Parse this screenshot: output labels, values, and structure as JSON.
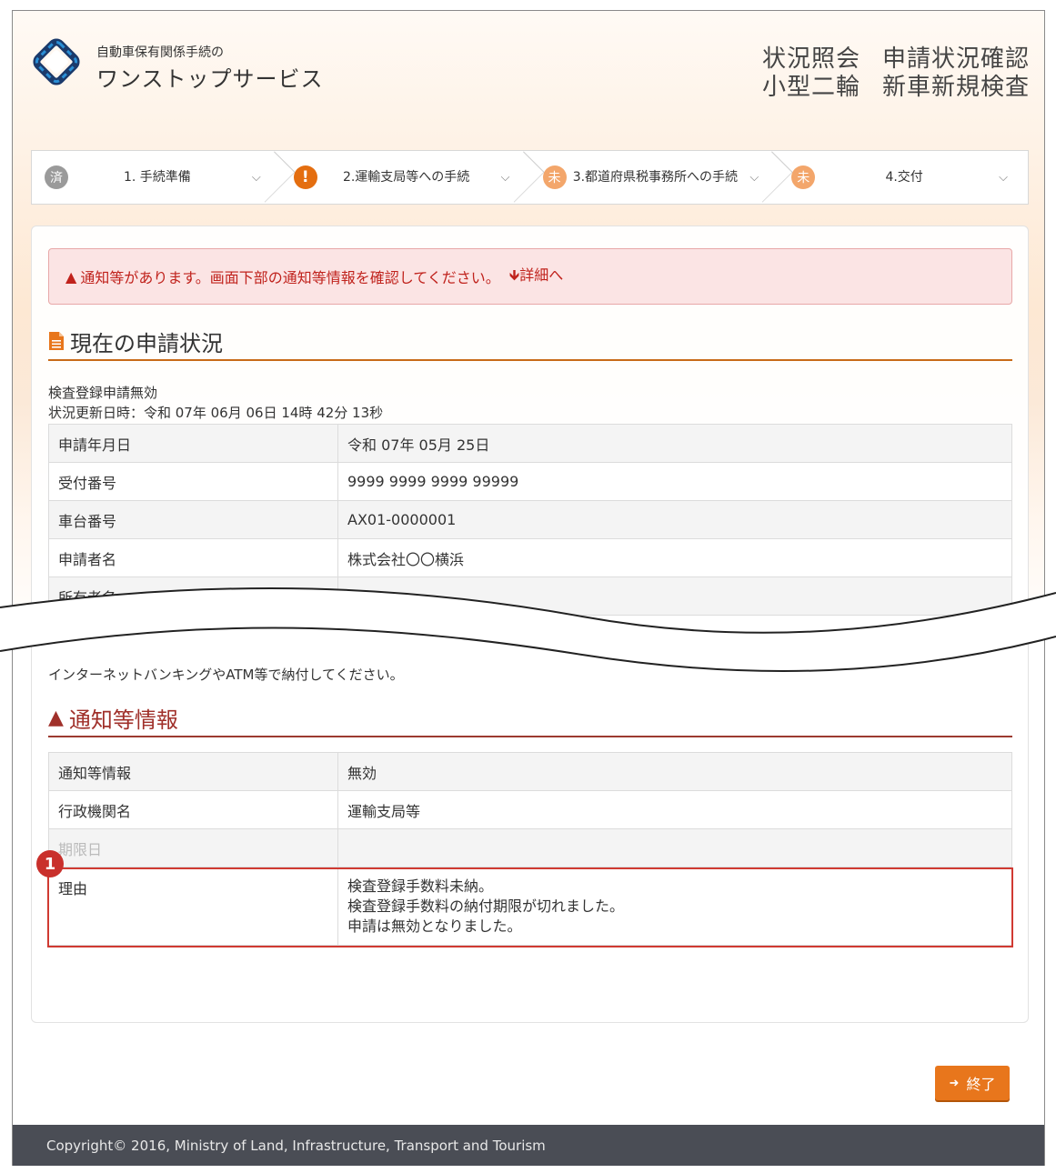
{
  "header": {
    "logo_sub": "自動車保有関係手続の",
    "logo_main": "ワンストップサービス",
    "title_line1_a": "状況照会",
    "title_line1_b": "申請状況確認",
    "title_line2_a": "小型二輪",
    "title_line2_b": "新車新規検査"
  },
  "steps": [
    {
      "badge": "済",
      "label": "1. 手続準備",
      "state": "done"
    },
    {
      "badge": "!",
      "label": "2.運輸支局等への手続",
      "state": "warning"
    },
    {
      "badge": "未",
      "label": "3.都道府県税事務所への手続",
      "state": "todo"
    },
    {
      "badge": "未",
      "label": "4.交付",
      "state": "todo"
    }
  ],
  "alert": {
    "text": "通知等があります。画面下部の通知等情報を確認してください。",
    "detail_link": "詳細へ"
  },
  "current_status": {
    "heading": "現在の申請状況",
    "status": "検査登録申請無効",
    "updated": "状況更新日時：令和 07年 06月 06日 14時 42分 13秒",
    "rows": [
      {
        "key": "申請年月日",
        "value": "令和 07年 05月 25日"
      },
      {
        "key": "受付番号",
        "value": "9999 9999 9999 99999"
      },
      {
        "key": "車台番号",
        "value": "AX01-0000001"
      },
      {
        "key": "申請者名",
        "value": "株式会社〇〇横浜"
      },
      {
        "key": "所有者名",
        "value": ""
      }
    ]
  },
  "payment_note": "インターネットバンキングやATM等で納付してください。",
  "notice_info": {
    "heading": "通知等情報",
    "rows": [
      {
        "key": "通知等情報",
        "value": "無効"
      },
      {
        "key": "行政機関名",
        "value": "運輸支局等"
      },
      {
        "key": "期限日",
        "value": ""
      }
    ],
    "reason_key": "理由",
    "reason_lines": [
      "検査登録手数料未納。",
      "検査登録手数料の納付期限が切れました。",
      "申請は無効となりました。"
    ],
    "marker": "1"
  },
  "buttons": {
    "end": "終了"
  },
  "footer": "Copyright© 2016, Ministry of Land, Infrastructure, Transport and Tourism",
  "colors": {
    "accent": "#e8761c",
    "alert_text": "#c0221c",
    "highlight": "#d03a32",
    "footer_bg": "#4a4d55"
  }
}
